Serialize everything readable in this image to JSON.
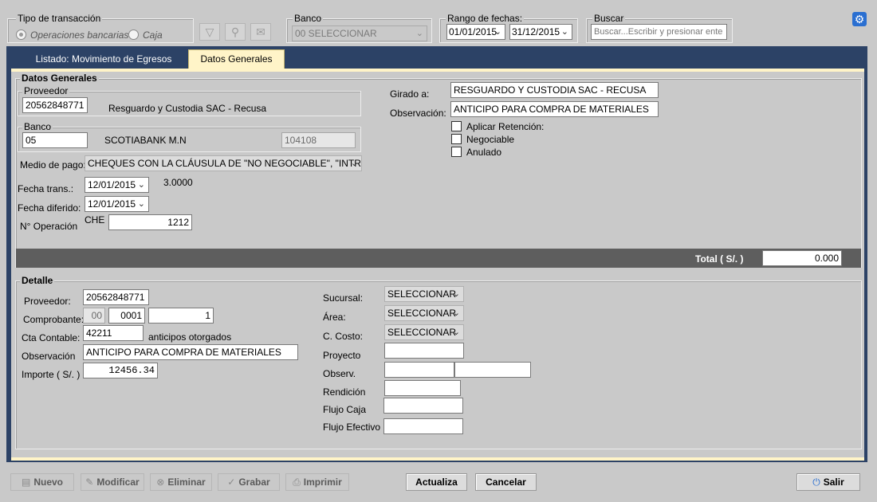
{
  "filters": {
    "tipo_title": "Tipo de transacción",
    "radio_operaciones": "Operaciones bancarias",
    "radio_caja": "Caja",
    "banco_title": "Banco",
    "banco_value": "00 SELECCIONAR",
    "rango_title": "Rango de fechas:",
    "date_from": "01/01/2015",
    "date_to": "31/12/2015",
    "buscar_title": "Buscar",
    "buscar_placeholder": "Buscar...Escribir y presionar ente"
  },
  "tabs": [
    {
      "label": "Listado: Movimiento de Egresos"
    },
    {
      "label": "Datos Generales"
    }
  ],
  "datos": {
    "section_title": "Datos Generales",
    "proveedor_title": "Proveedor",
    "proveedor_code": "20562848771",
    "proveedor_name": "Resguardo y Custodia SAC - Recusa",
    "banco_title": "Banco",
    "banco_code": "05",
    "banco_name": "SCOTIABANK M.N",
    "banco_account": "104108",
    "medio_label": "Medio de pago:",
    "medio_value": "CHEQUES CON LA CLÁUSULA DE \"NO NEGOCIABLE\", \"INTRAN",
    "fecha_trans_label": "Fecha trans.:",
    "fecha_trans_value": "12/01/2015",
    "tipo_cambio": "3.0000",
    "fecha_diferido_label": "Fecha diferido:",
    "fecha_diferido_value": "12/01/2015",
    "operacion_label": "N° Operación",
    "operacion_prefix": "CHE",
    "operacion_value": "1212",
    "girado_label": "Girado a:",
    "girado_value": "RESGUARDO Y CUSTODIA SAC - RECUSA",
    "observacion_label": "Observación:",
    "observacion_value": "ANTICIPO PARA COMPRA DE MATERIALES",
    "aplicar_retencion": "Aplicar Retención:",
    "negociable": "Negociable",
    "anulado": "Anulado",
    "total_label": "Total ( S/. )",
    "total_value": "0.000"
  },
  "detalle": {
    "section_title": "Detalle",
    "proveedor_label": "Proveedor:",
    "proveedor_value": "20562848771",
    "comprobante_label": "Comprobante:",
    "comp_tipo": "00",
    "comp_serie": "0001",
    "comp_numero": "1",
    "cta_label": "Cta Contable:",
    "cta_value": "42211",
    "cta_desc": "anticipos otorgados",
    "obs_label": "Observación",
    "obs_value": "ANTICIPO PARA COMPRA DE MATERIALES",
    "importe_label": "Importe ( S/. )",
    "importe_value": "12456.34",
    "sucursal_label": "Sucursal:",
    "sucursal_value": "SELECCIONAR",
    "area_label": "Área:",
    "area_value": "SELECCIONAR",
    "ccosto_label": "C. Costo:",
    "ccosto_value": "SELECCIONAR",
    "proyecto_label": "Proyecto",
    "observ_label": "Observ.",
    "rendicion_label": "Rendición",
    "flujo_caja_label": "Flujo Caja",
    "flujo_efectivo_label": "Flujo Efectivo"
  },
  "toolbar": {
    "nuevo": "Nuevo",
    "modificar": "Modificar",
    "eliminar": "Eliminar",
    "grabar": "Grabar",
    "imprimir": "Imprimir",
    "actualiza": "Actualiza",
    "cancelar": "Cancelar",
    "salir": "Salir"
  },
  "colors": {
    "navy_bar": "#2c4266",
    "tab_active": "#fff4c8",
    "total_bar": "#5e5e5e"
  }
}
